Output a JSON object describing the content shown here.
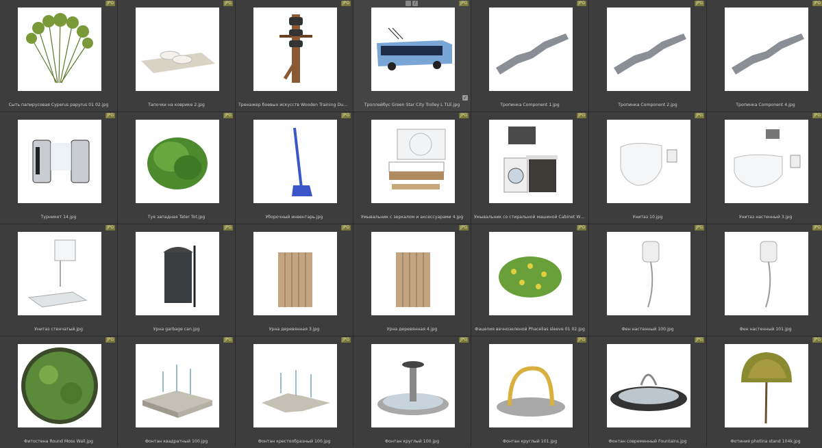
{
  "badge_label": "JPG",
  "colors": {
    "background": "#3b3b3b",
    "badge": "#7b7a3c",
    "caption": "#cfcfcf"
  },
  "items": [
    {
      "name": "Сыть папирусовая Cyperus papyrus 01 02.jpg",
      "icon": "papyrus-plant-icon"
    },
    {
      "name": "Тапочки на коврике 2.jpg",
      "icon": "slippers-on-rug-icon"
    },
    {
      "name": "Тренажер боевых искусств Wooden Training Dummy.jpg",
      "icon": "training-dummy-icon"
    },
    {
      "name": "Троллейбус Green Star City Trolley L TLE.jpg",
      "icon": "trolleybus-icon",
      "selected": true
    },
    {
      "name": "Тропинка Component 1.jpg",
      "icon": "path-component-icon"
    },
    {
      "name": "Тропинка Component 2.jpg",
      "icon": "path-component-icon"
    },
    {
      "name": "Тропинка Component 4.jpg",
      "icon": "path-component-icon"
    },
    {
      "name": "Турникет 14.jpg",
      "icon": "turnstile-icon"
    },
    {
      "name": "Туя западная Tater Tot.jpg",
      "icon": "thuja-bush-icon"
    },
    {
      "name": "Уборочный инвентарь.jpg",
      "icon": "cleaning-tool-icon"
    },
    {
      "name": "Умывальник с зеркалом и аксессуарами 4.jpg",
      "icon": "washbasin-mirror-icon"
    },
    {
      "name": "Умывальник со стиральной машиной Cabinet With Washing Machine.jpg",
      "icon": "washing-machine-cabinet-icon"
    },
    {
      "name": "Унитаз 10.jpg",
      "icon": "toilet-icon"
    },
    {
      "name": "Унитаз настенный 3.jpg",
      "icon": "wall-toilet-icon"
    },
    {
      "name": "Унитаз стенчатый.jpg",
      "icon": "squat-toilet-icon"
    },
    {
      "name": "Урна garbage can.jpg",
      "icon": "garbage-can-icon"
    },
    {
      "name": "Урна деревянная 3.jpg",
      "icon": "wooden-bin-icon"
    },
    {
      "name": "Урна деревянная 4.jpg",
      "icon": "wooden-bin-icon"
    },
    {
      "name": "Фацелия вечнозеленой Phacelias sleeve 01 02.jpg",
      "icon": "flower-bush-icon"
    },
    {
      "name": "Фен настенный 100.jpg",
      "icon": "hair-dryer-icon"
    },
    {
      "name": "Фен настенный 101.jpg",
      "icon": "hair-dryer-icon"
    },
    {
      "name": "Фитостена Round Moss Wall.jpg",
      "icon": "moss-wall-icon"
    },
    {
      "name": "Фонтан квадратный 100.jpg",
      "icon": "square-fountain-icon"
    },
    {
      "name": "Фонтан крестообразный 100.jpg",
      "icon": "cross-fountain-icon"
    },
    {
      "name": "Фонтан круглый 100.jpg",
      "icon": "round-fountain-icon"
    },
    {
      "name": "Фонтан круглый 101.jpg",
      "icon": "ring-fountain-icon"
    },
    {
      "name": "Фонтан современный Fountains.jpg",
      "icon": "modern-fountain-icon"
    },
    {
      "name": "Фотиния photina stand 104k.jpg",
      "icon": "topiary-tree-icon"
    }
  ]
}
